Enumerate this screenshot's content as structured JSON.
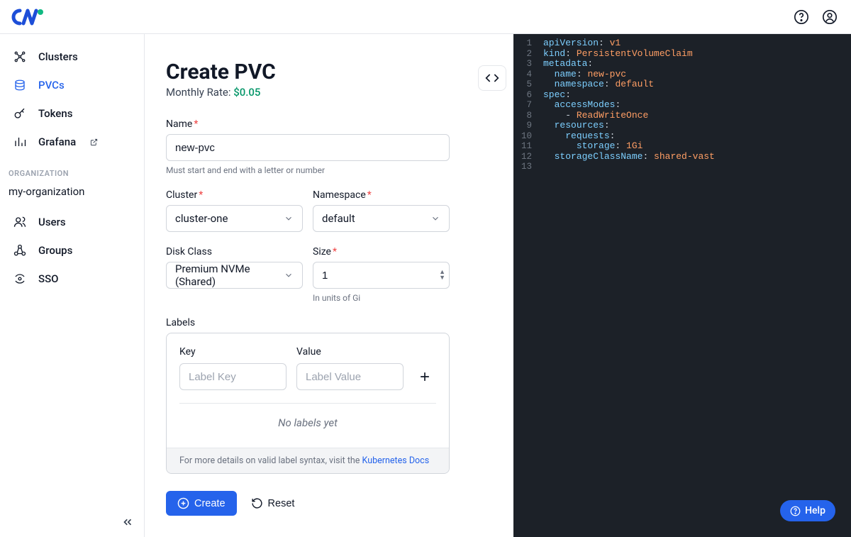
{
  "topbar": {
    "help_icon": "help",
    "profile_icon": "profile"
  },
  "sidebar": {
    "items": [
      {
        "label": "Clusters",
        "icon": "clusters"
      },
      {
        "label": "PVCs",
        "icon": "pvcs",
        "active": true
      },
      {
        "label": "Tokens",
        "icon": "tokens"
      },
      {
        "label": "Grafana",
        "icon": "grafana",
        "external": true
      }
    ],
    "org_section_label": "ORGANIZATION",
    "org_name": "my-organization",
    "org_items": [
      {
        "label": "Users",
        "icon": "users"
      },
      {
        "label": "Groups",
        "icon": "groups"
      },
      {
        "label": "SSO",
        "icon": "sso"
      }
    ]
  },
  "form": {
    "title": "Create PVC",
    "rate_label": "Monthly Rate: ",
    "rate_value": "$0.05",
    "name_label": "Name",
    "name_value": "new-pvc",
    "name_hint": "Must start and end with a letter or number",
    "cluster_label": "Cluster",
    "cluster_value": "cluster-one",
    "namespace_label": "Namespace",
    "namespace_value": "default",
    "disk_label": "Disk Class",
    "disk_value": "Premium NVMe (Shared)",
    "size_label": "Size",
    "size_value": "1",
    "size_hint": "In units of Gi",
    "labels_label": "Labels",
    "labels_key_header": "Key",
    "labels_value_header": "Value",
    "labels_key_placeholder": "Label Key",
    "labels_value_placeholder": "Label Value",
    "no_labels": "No labels yet",
    "labels_footer_prefix": "For more details on valid label syntax, visit the ",
    "labels_footer_link": "Kubernetes Docs",
    "create_btn": "Create",
    "reset_btn": "Reset"
  },
  "yaml": {
    "line_count": 13,
    "lines": [
      {
        "key": "apiVersion",
        "val": "v1",
        "indent": 0
      },
      {
        "key": "kind",
        "val": "PersistentVolumeClaim",
        "indent": 0
      },
      {
        "key": "metadata",
        "val": "",
        "indent": 0
      },
      {
        "key": "name",
        "val": "new-pvc",
        "indent": 1
      },
      {
        "key": "namespace",
        "val": "default",
        "indent": 1
      },
      {
        "key": "spec",
        "val": "",
        "indent": 0
      },
      {
        "key": "accessModes",
        "val": "",
        "indent": 1
      },
      {
        "dash": true,
        "val": "ReadWriteOnce",
        "indent": 2
      },
      {
        "key": "resources",
        "val": "",
        "indent": 1
      },
      {
        "key": "requests",
        "val": "",
        "indent": 2
      },
      {
        "key": "storage",
        "val": "1Gi",
        "indent": 3
      },
      {
        "key": "storageClassName",
        "val": "shared-vast",
        "indent": 1
      }
    ]
  },
  "help_fab": "Help"
}
